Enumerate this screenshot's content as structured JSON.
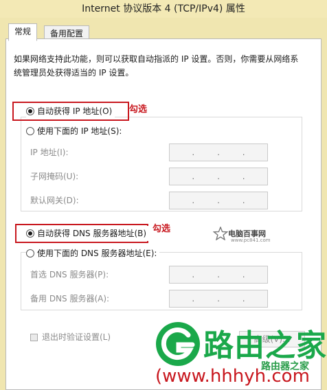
{
  "window": {
    "title": "Internet 协议版本 4 (TCP/IPv4) 属性"
  },
  "tabs": [
    {
      "label": "常规",
      "active": true
    },
    {
      "label": "备用配置",
      "active": false
    }
  ],
  "description": "如果网络支持此功能，则可以获取自动指派的 IP 设置。否则，你需要从网络系统管理员处获得适当的 IP 设置。",
  "ip_section": {
    "auto_label": "自动获得 IP 地址(O)",
    "auto_selected": true,
    "manual_label": "使用下面的 IP 地址(S):",
    "fields": [
      {
        "label": "IP 地址(I):",
        "value": ". . ."
      },
      {
        "label": "子网掩码(U):",
        "value": ". . ."
      },
      {
        "label": "默认网关(D):",
        "value": ". . ."
      }
    ]
  },
  "dns_section": {
    "auto_label": "自动获得 DNS 服务器地址(B)",
    "auto_selected": true,
    "manual_label": "使用下面的 DNS 服务器地址(E):",
    "fields": [
      {
        "label": "首选 DNS 服务器(P):",
        "value": ". . ."
      },
      {
        "label": "备用 DNS 服务器(A):",
        "value": ". . ."
      }
    ]
  },
  "annotations": {
    "pick_1": "勾选",
    "pick_2": "勾选",
    "color": "#c8171e"
  },
  "validate_checkbox": {
    "label": "退出时验证设置(L)",
    "checked": false
  },
  "buttons": {
    "advanced": "高级(V)..."
  },
  "watermarks": {
    "site_name": "电脑百事网",
    "site_url": "www.pc841.com",
    "brand": "路由之家",
    "brand_url": "(www.hhhyh.com",
    "brand_small": "路由器之家",
    "brand_color": "#1aa84a"
  }
}
